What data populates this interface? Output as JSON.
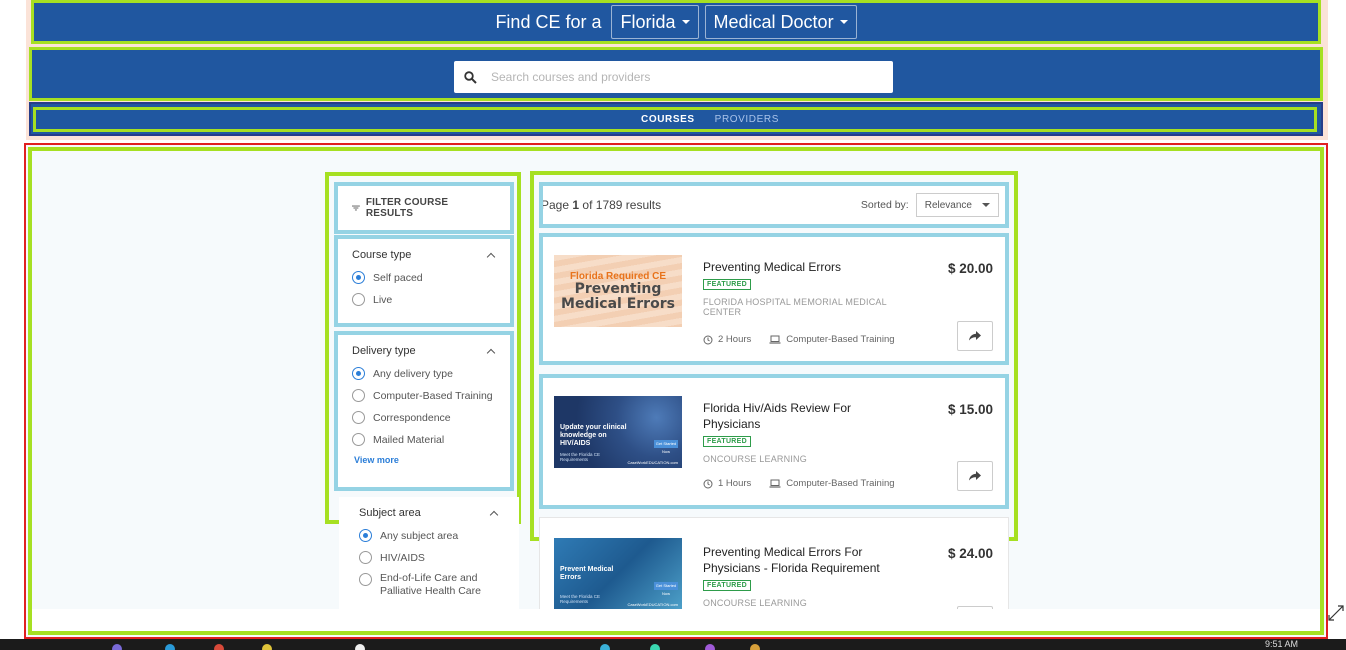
{
  "header": {
    "find_label": "Find CE for a",
    "state_select": "Florida",
    "profession_select": "Medical Doctor"
  },
  "search": {
    "placeholder": "Search courses and providers"
  },
  "tabs": [
    {
      "label": "COURSES",
      "active": true
    },
    {
      "label": "PROVIDERS",
      "active": false
    }
  ],
  "filters": {
    "title": "FILTER COURSE RESULTS",
    "course_type": {
      "title": "Course type",
      "options": [
        {
          "label": "Self paced",
          "checked": true
        },
        {
          "label": "Live",
          "checked": false
        }
      ]
    },
    "delivery_type": {
      "title": "Delivery type",
      "options": [
        {
          "label": "Any delivery type",
          "checked": true
        },
        {
          "label": "Computer-Based Training",
          "checked": false
        },
        {
          "label": "Correspondence",
          "checked": false
        },
        {
          "label": "Mailed Material",
          "checked": false
        }
      ],
      "view_more": "View more"
    },
    "subject_area": {
      "title": "Subject area",
      "options": [
        {
          "label": "Any subject area",
          "checked": true
        },
        {
          "label": "HIV/AIDS",
          "checked": false
        },
        {
          "label": "End-of-Life Care and Palliative Health Care",
          "checked": false
        }
      ]
    }
  },
  "results": {
    "page_prefix": "Page",
    "page": "1",
    "of_text": "of",
    "total": "1789 results",
    "sorted_by_label": "Sorted by:",
    "sort_value": "Relevance"
  },
  "courses": [
    {
      "title": "Preventing Medical Errors",
      "badge": "FEATURED",
      "provider": "FLORIDA HOSPITAL MEMORIAL MEDICAL CENTER",
      "hours": "2 Hours",
      "format": "Computer-Based Training",
      "price": "$ 20.00",
      "thumb_line1": "Florida Required CE",
      "thumb_line2": "Preventing",
      "thumb_line3": "Medical Errors"
    },
    {
      "title": "Florida Hiv/Aids Review For Physicians",
      "badge": "FEATURED",
      "provider": "ONCOURSE LEARNING",
      "hours": "1 Hours",
      "format": "Computer-Based Training",
      "price": "$ 15.00",
      "thumb_text": "Update your clinical knowledge on HIV/AIDS",
      "thumb_sub": "Meet the Florida CE Requirements",
      "thumb_btn": "Get Started Now",
      "thumb_foot": "CaseWorkEDUCATION.com"
    },
    {
      "title": "Preventing Medical Errors For Physicians - Florida Requirement",
      "badge": "FEATURED",
      "provider": "ONCOURSE LEARNING",
      "price": "$ 24.00",
      "thumb_text": "Prevent Medical Errors",
      "thumb_sub": "Meet the Florida CE Requirements",
      "thumb_btn": "Get Started Now",
      "thumb_foot": "CaseWorkEDUCATION.com"
    }
  ],
  "taskbar": {
    "clock": "9:51 AM"
  },
  "colors": {
    "header_blue": "#2057a0",
    "annotation_green": "#a6e022",
    "annotation_light_blue": "#95d3e4",
    "annotation_red": "#e02020",
    "featured_green": "#2e9c4a",
    "link_blue": "#2b7ed8"
  }
}
